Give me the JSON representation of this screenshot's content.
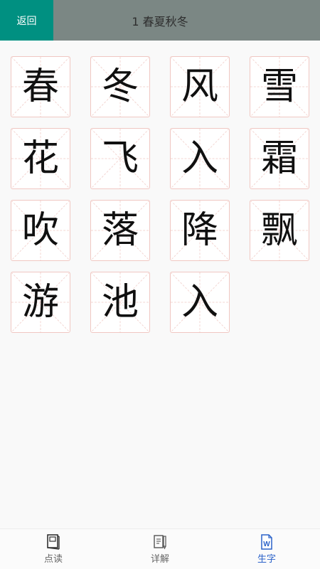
{
  "header": {
    "back_label": "返回",
    "title": "1 春夏秋冬"
  },
  "characters": [
    "春",
    "冬",
    "风",
    "雪",
    "花",
    "飞",
    "入",
    "霜",
    "吹",
    "落",
    "降",
    "飘",
    "游",
    "池",
    "入"
  ],
  "nav": [
    {
      "label": "点读",
      "icon": "book-icon"
    },
    {
      "label": "详解",
      "icon": "document-pen-icon"
    },
    {
      "label": "生字",
      "icon": "word-doc-icon",
      "active": true
    }
  ],
  "colors": {
    "header_bg": "#7b8784",
    "back_bg": "#009081",
    "card_border": "#f0c7c2",
    "active_nav": "#2b62c9"
  }
}
